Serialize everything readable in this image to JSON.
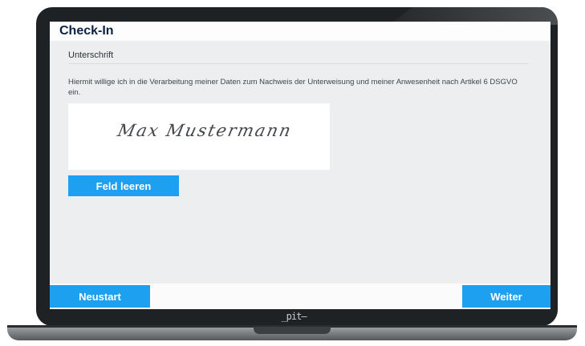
{
  "app": {
    "title": "Check-In"
  },
  "section": {
    "title": "Unterschrift",
    "consent_text": "Hiermit willige ich in die Verarbeitung meiner Daten zum Nachweis der Unterweisung und meiner Anwesenheit nach Artikel 6 DSGVO ein."
  },
  "signature": {
    "value": "Max Mustermann"
  },
  "buttons": {
    "clear_label": "Feld leeren",
    "restart_label": "Neustart",
    "next_label": "Weiter"
  },
  "device": {
    "brand": "_pit—"
  },
  "colors": {
    "accent": "#1ea0f0",
    "title": "#0b2240",
    "screen_bg": "#eceef0"
  }
}
